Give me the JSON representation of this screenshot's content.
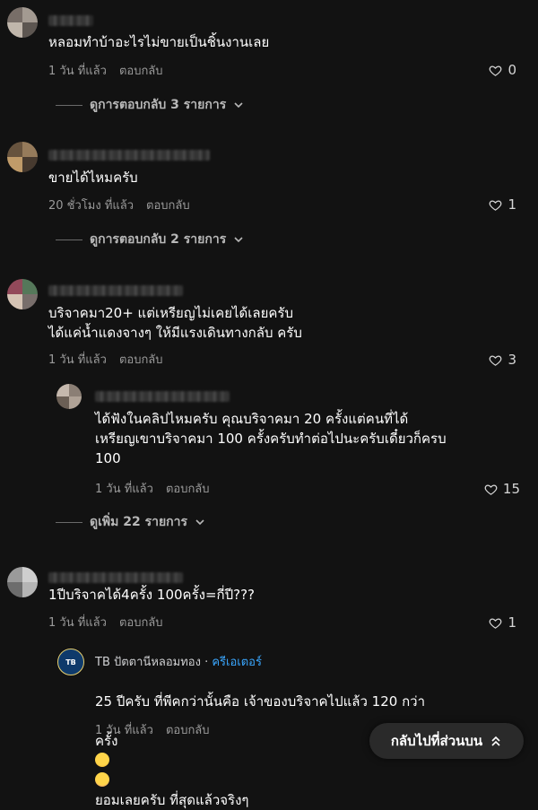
{
  "comments": [
    {
      "text": "หลอมทำบ้าอะไรไม่ขายเป็นชิ้นงานเลย",
      "time": "1 วัน ที่แล้ว",
      "reply_label": "ตอบกลับ",
      "likes": "0",
      "view_replies": "ดูการตอบกลับ 3 รายการ"
    },
    {
      "text": "ขายได้ไหมครับ",
      "time": "20 ชั่วโมง ที่แล้ว",
      "reply_label": "ตอบกลับ",
      "likes": "1",
      "view_replies": "ดูการตอบกลับ 2 รายการ"
    },
    {
      "text": "บริจาคมา20+ แต่เหรียญไม่เคยได้เลยครับ\nได้แค่น้ำแดงจางๆ ให้มีแรงเดินทางกลับ ครับ",
      "time": "1 วัน ที่แล้ว",
      "reply_label": "ตอบกลับ",
      "likes": "3",
      "reply": {
        "text": "ได้ฟังในคลิปไหมครับ คุณบริจาคมา 20 ครั้งแต่คนที่ได้\nเหรียญเขาบริจาคมา 100 ครั้งครับทำต่อไปนะครับเดี๋ยวก็ครบ\n100",
        "time": "1 วัน ที่แล้ว",
        "reply_label": "ตอบกลับ",
        "likes": "15"
      },
      "view_replies": "ดูเพิ่ม 22 รายการ"
    },
    {
      "text": "1ปีบริจาคได้4ครั้ง 100ครั้ง=กี่ปี???",
      "time": "1 วัน ที่แล้ว",
      "reply_label": "ตอบกลับ",
      "likes": "1",
      "reply": {
        "author": "TB ปัตตานีหลอมทอง",
        "badge": "ครีเอเตอร์",
        "avatar_text": "TB",
        "text_line1": "25 ปีครับ ที่พีคกว่านั้นคือ เจ้าของบริจาคไปแล้ว 120 กว่า",
        "text_line2_pre": "ครั้ง",
        "text_line2_post": "ยอมเลยครับ ที่สุดแล้วจริงๆ",
        "time": "1 วัน ที่แล้ว",
        "reply_label": "ตอบกลับ"
      }
    }
  ],
  "back_to_top": "กลับไปที่ส่วนบน",
  "colors": {
    "background": "#121212",
    "creator_blue": "#3aa7ff",
    "meta_gray": "#9a9a9a"
  },
  "icons": {
    "like": "heart-outline-icon",
    "expand": "chevron-down-icon",
    "top": "double-chevron-up-icon"
  }
}
